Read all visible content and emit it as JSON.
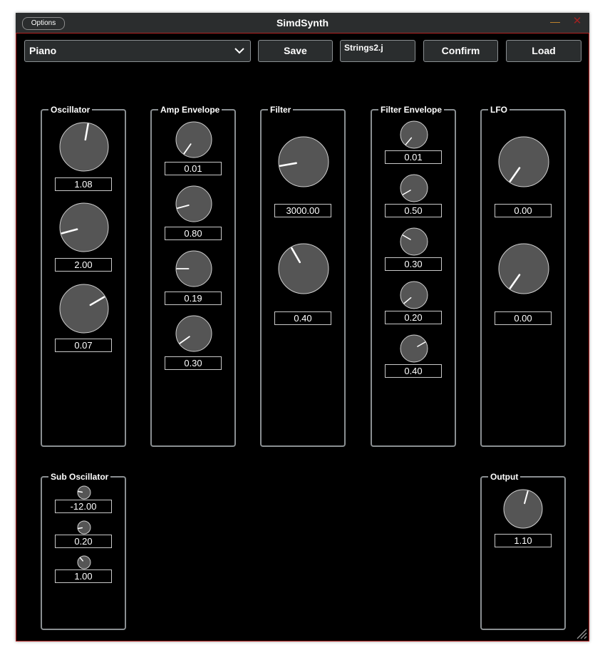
{
  "window": {
    "title": "SimdSynth",
    "options_label": "Options",
    "minimize_glyph": "—",
    "close_glyph": "✕"
  },
  "toolbar": {
    "preset_value": "Piano",
    "save_label": "Save",
    "name_value": "Strings2.j",
    "confirm_label": "Confirm",
    "load_label": "Load"
  },
  "groups": {
    "oscillator": {
      "label": "Oscillator",
      "knobs": [
        {
          "value": "1.08",
          "angle": 10
        },
        {
          "value": "2.00",
          "angle": -105
        },
        {
          "value": "0.07",
          "angle": 60
        }
      ]
    },
    "amp_envelope": {
      "label": "Amp Envelope",
      "knobs": [
        {
          "value": "0.01",
          "angle": -145
        },
        {
          "value": "0.80",
          "angle": -105
        },
        {
          "value": "0.19",
          "angle": -90
        },
        {
          "value": "0.30",
          "angle": -125
        }
      ]
    },
    "filter": {
      "label": "Filter",
      "knobs": [
        {
          "value": "3000.00",
          "angle": -100
        },
        {
          "value": "0.40",
          "angle": -30
        }
      ]
    },
    "filter_envelope": {
      "label": "Filter Envelope",
      "knobs": [
        {
          "value": "0.01",
          "angle": -140
        },
        {
          "value": "0.50",
          "angle": -120
        },
        {
          "value": "0.30",
          "angle": -60
        },
        {
          "value": "0.20",
          "angle": -130
        },
        {
          "value": "0.40",
          "angle": 60
        }
      ]
    },
    "lfo": {
      "label": "LFO",
      "knobs": [
        {
          "value": "0.00",
          "angle": -145
        },
        {
          "value": "0.00",
          "angle": -145
        }
      ]
    },
    "sub_oscillator": {
      "label": "Sub Oscillator",
      "knobs": [
        {
          "value": "-12.00",
          "angle": -80
        },
        {
          "value": "0.20",
          "angle": -100
        },
        {
          "value": "1.00",
          "angle": -40
        }
      ]
    },
    "output": {
      "label": "Output",
      "knobs": [
        {
          "value": "1.10",
          "angle": 15
        }
      ]
    }
  },
  "colors": {
    "knob_fill": "#555555",
    "knob_rim": "#d0d0d0",
    "pointer": "#ffffff",
    "accent_border": "#b22222"
  }
}
